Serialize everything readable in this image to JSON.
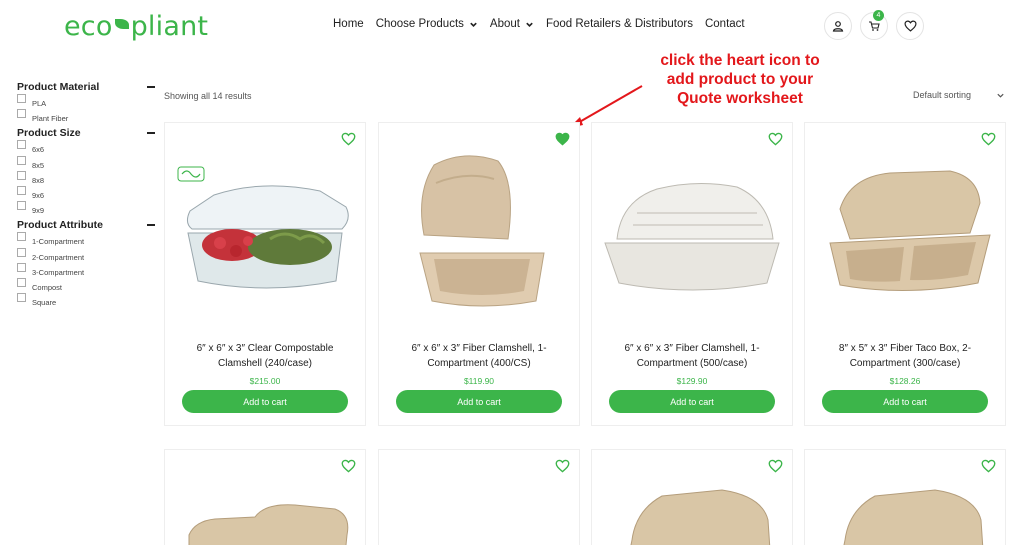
{
  "brand": {
    "logo_left": "eco",
    "logo_right": "pliant",
    "accent": "#3cb54a"
  },
  "nav": [
    {
      "label": "Home",
      "has_dropdown": false
    },
    {
      "label": "Choose Products",
      "has_dropdown": true
    },
    {
      "label": "About",
      "has_dropdown": true
    },
    {
      "label": "Food Retailers & Distributors",
      "has_dropdown": false
    },
    {
      "label": "Contact",
      "has_dropdown": false
    }
  ],
  "header_icons": {
    "account": "user-icon",
    "cart": "cart-icon",
    "cart_count": "4",
    "wishlist": "heart-icon"
  },
  "annotation": {
    "line1": "click the heart icon to",
    "line2": "add product to your",
    "line3": "Quote worksheet",
    "color": "#e3171b"
  },
  "sidebar": {
    "groups": [
      {
        "title": "Product Material",
        "options": [
          "PLA",
          "Plant Fiber"
        ]
      },
      {
        "title": "Product Size",
        "options": [
          "6x6",
          "8x5",
          "8x8",
          "9x6",
          "9x9"
        ]
      },
      {
        "title": "Product Attribute",
        "options": [
          "1-Compartment",
          "2-Compartment",
          "3-Compartment",
          "Compost",
          "Square"
        ]
      }
    ]
  },
  "toolbar": {
    "results_text": "Showing all 14 results",
    "sort_label": "Default sorting"
  },
  "products": [
    {
      "title": "6″ x 6″ x 3″ Clear Compostable Clamshell (240/case)",
      "price": "$215.00",
      "button": "Add to cart",
      "wishlisted": false,
      "image": "clear-clamshell-with-salad"
    },
    {
      "title": "6″ x 6″ x 3″ Fiber Clamshell, 1-Compartment (400/CS)",
      "price": "$119.90",
      "button": "Add to cart",
      "wishlisted": true,
      "image": "fiber-clamshell-open"
    },
    {
      "title": "6″ x 6″ x 3″ Fiber Clamshell, 1-Compartment (500/case)",
      "price": "$129.90",
      "button": "Add to cart",
      "wishlisted": false,
      "image": "white-fiber-clamshell"
    },
    {
      "title": "8″ x 5″ x 3″ Fiber Taco Box, 2-Compartment (300/case)",
      "price": "$128.26",
      "button": "Add to cart",
      "wishlisted": false,
      "image": "fiber-taco-box"
    },
    {
      "wishlisted": false,
      "image": "fiber-3-compartment"
    },
    {
      "wishlisted": false,
      "image": ""
    },
    {
      "wishlisted": false,
      "image": "fiber-clamshell-closed"
    },
    {
      "wishlisted": false,
      "image": "fiber-clamshell-closed"
    }
  ]
}
